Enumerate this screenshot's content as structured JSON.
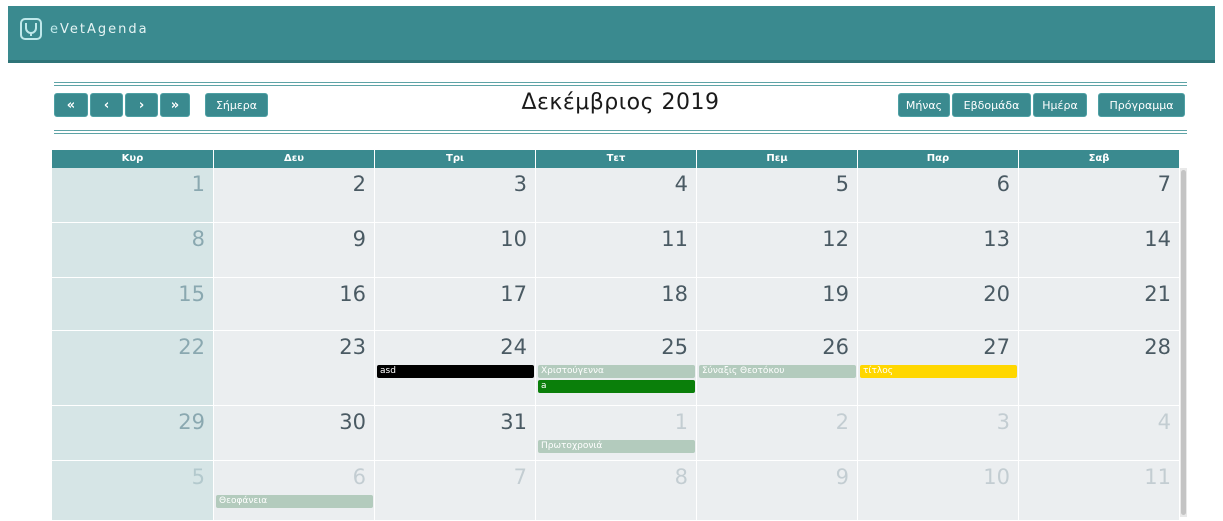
{
  "app": {
    "logo_icon": "stethoscope-icon",
    "brand_e": "e",
    "brand_rest": "VetAgenda"
  },
  "toolbar": {
    "first_label": "«",
    "prev_label": "‹",
    "next_label": "›",
    "last_label": "»",
    "today_label": "Σήμερα",
    "title": "Δεκέμβριος 2019",
    "month_label": "Μήνας",
    "week_label": "Εβδομάδα",
    "day_label": "Ημέρα",
    "schedule_label": "Πρόγραμμα"
  },
  "weekdays": [
    "Κυρ",
    "Δευ",
    "Τρι",
    "Τετ",
    "Πεμ",
    "Παρ",
    "Σαβ"
  ],
  "weeks": [
    {
      "days": [
        "1",
        "2",
        "3",
        "4",
        "5",
        "6",
        "7"
      ],
      "other": [
        false,
        false,
        false,
        false,
        false,
        false,
        false
      ]
    },
    {
      "days": [
        "8",
        "9",
        "10",
        "11",
        "12",
        "13",
        "14"
      ],
      "other": [
        false,
        false,
        false,
        false,
        false,
        false,
        false
      ]
    },
    {
      "days": [
        "15",
        "16",
        "17",
        "18",
        "19",
        "20",
        "21"
      ],
      "other": [
        false,
        false,
        false,
        false,
        false,
        false,
        false
      ]
    },
    {
      "days": [
        "22",
        "23",
        "24",
        "25",
        "26",
        "27",
        "28"
      ],
      "other": [
        false,
        false,
        false,
        false,
        false,
        false,
        false
      ]
    },
    {
      "days": [
        "29",
        "30",
        "31",
        "1",
        "2",
        "3",
        "4"
      ],
      "other": [
        false,
        false,
        false,
        true,
        true,
        true,
        true
      ]
    },
    {
      "days": [
        "5",
        "6",
        "7",
        "8",
        "9",
        "10",
        "11"
      ],
      "other": [
        true,
        true,
        true,
        true,
        true,
        true,
        true
      ]
    }
  ],
  "events": [
    {
      "week": 3,
      "col": 2,
      "slot": 0,
      "label": "asd",
      "bg": "#000000",
      "fg": "#ffffff"
    },
    {
      "week": 3,
      "col": 3,
      "slot": 0,
      "label": "Χριστούγεννα",
      "bg": "#b3cbbd",
      "fg": "#ffffff"
    },
    {
      "week": 3,
      "col": 3,
      "slot": 1,
      "label": "a",
      "bg": "#0a7f0a",
      "fg": "#ffffff"
    },
    {
      "week": 3,
      "col": 4,
      "slot": 0,
      "label": "Σύναξις Θεοτόκου",
      "bg": "#b3cbbd",
      "fg": "#ffffff"
    },
    {
      "week": 3,
      "col": 5,
      "slot": 0,
      "label": "τίτλος",
      "bg": "#ffd700",
      "fg": "#ffffff"
    },
    {
      "week": 4,
      "col": 3,
      "slot": 0,
      "label": "Πρωτοχρονιά",
      "bg": "#b3cbbd",
      "fg": "#ffffff"
    },
    {
      "week": 5,
      "col": 1,
      "slot": 0,
      "label": "Θεοφάνεια",
      "bg": "#b3cbbd",
      "fg": "#ffffff"
    }
  ]
}
